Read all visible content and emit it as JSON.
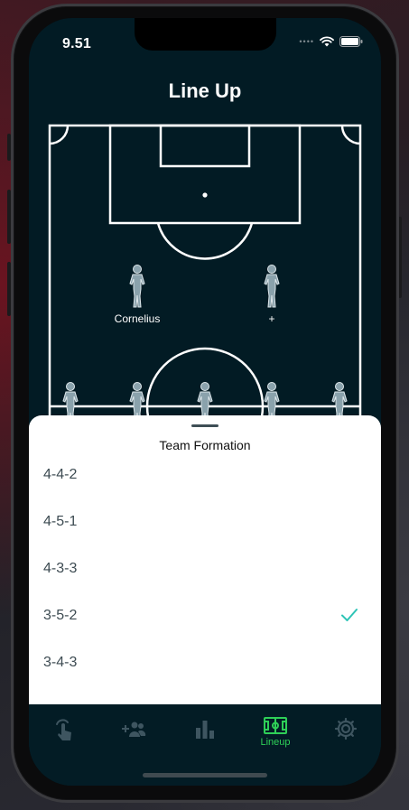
{
  "status_bar": {
    "time": "9.51"
  },
  "header": {
    "title": "Line Up"
  },
  "pitch": {
    "players": [
      {
        "label": "Cornelius"
      },
      {
        "label": "+"
      },
      {
        "label": ""
      },
      {
        "label": ""
      },
      {
        "label": ""
      },
      {
        "label": ""
      },
      {
        "label": ""
      }
    ]
  },
  "formation_sheet": {
    "title": "Team Formation",
    "options": [
      "4-4-2",
      "4-5-1",
      "4-3-3",
      "3-5-2",
      "3-4-3"
    ],
    "selected": "3-5-2",
    "check_color": "#2ec4b6"
  },
  "tab_bar": {
    "tabs": [
      {
        "icon": "tap-icon",
        "label": ""
      },
      {
        "icon": "add-players-icon",
        "label": ""
      },
      {
        "icon": "stats-icon",
        "label": ""
      },
      {
        "icon": "field-icon",
        "label": "Lineup",
        "active": true
      },
      {
        "icon": "gear-icon",
        "label": ""
      }
    ],
    "active_color": "#2ecf57",
    "inactive_color": "#3e5560"
  }
}
